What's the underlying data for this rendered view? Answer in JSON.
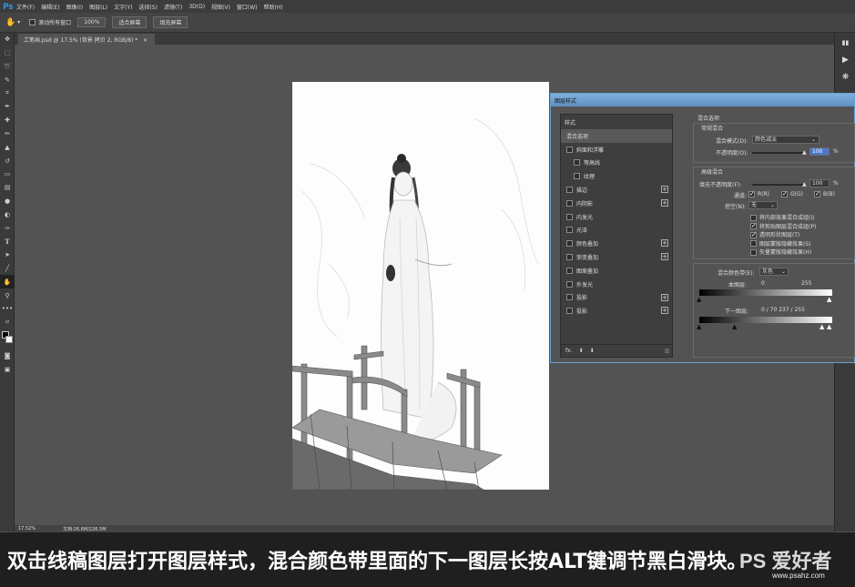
{
  "menubar": {
    "logo": "Ps",
    "items": [
      "文件(F)",
      "编辑(E)",
      "图像(I)",
      "图层(L)",
      "文字(Y)",
      "选择(S)",
      "滤镜(T)",
      "3D(D)",
      "视图(V)",
      "窗口(W)",
      "帮助(H)"
    ]
  },
  "options": {
    "scroll_all_label": "滚动所有窗口",
    "zoom_100": "100%",
    "fit_screen": "适合屏幕",
    "fill_screen": "填充屏幕"
  },
  "document": {
    "tab_title": "工笔画.psd @ 17.5% (背景 拷贝 2, RGB/8) *",
    "tab_close": "×"
  },
  "status": {
    "zoom": "17.52%",
    "doc_info": "文档:26.6M/226.5M"
  },
  "dialog": {
    "title": "图层样式",
    "styles_header": "样式",
    "styles": [
      {
        "label": "混合选项",
        "selected": true,
        "checkbox": false,
        "sub": false,
        "plus": false
      },
      {
        "label": "斜面和浮雕",
        "selected": false,
        "checkbox": true,
        "sub": false,
        "plus": false
      },
      {
        "label": "等高线",
        "selected": false,
        "checkbox": true,
        "sub": true,
        "plus": false
      },
      {
        "label": "纹理",
        "selected": false,
        "checkbox": true,
        "sub": true,
        "plus": false
      },
      {
        "label": "描边",
        "selected": false,
        "checkbox": true,
        "sub": false,
        "plus": true
      },
      {
        "label": "内阴影",
        "selected": false,
        "checkbox": true,
        "sub": false,
        "plus": true
      },
      {
        "label": "内发光",
        "selected": false,
        "checkbox": true,
        "sub": false,
        "plus": false
      },
      {
        "label": "光泽",
        "selected": false,
        "checkbox": true,
        "sub": false,
        "plus": false
      },
      {
        "label": "颜色叠加",
        "selected": false,
        "checkbox": true,
        "sub": false,
        "plus": true
      },
      {
        "label": "渐变叠加",
        "selected": false,
        "checkbox": true,
        "sub": false,
        "plus": true
      },
      {
        "label": "图案叠加",
        "selected": false,
        "checkbox": true,
        "sub": false,
        "plus": false
      },
      {
        "label": "外发光",
        "selected": false,
        "checkbox": true,
        "sub": false,
        "plus": false
      },
      {
        "label": "投影",
        "selected": false,
        "checkbox": true,
        "sub": false,
        "plus": true
      },
      {
        "label": "投影",
        "selected": false,
        "checkbox": true,
        "sub": false,
        "plus": true
      }
    ],
    "footer": {
      "fx": "fx.",
      "up": "⬆",
      "down": "⬇",
      "trash": "🗑"
    },
    "blend_options_title": "混合选项",
    "general_blend": "常规混合",
    "blend_mode_label": "混合模式(D):",
    "blend_mode_value": "颜色减淡",
    "opacity_label": "不透明度(O):",
    "opacity_value": "100",
    "percent": "%",
    "advanced_blend": "高级混合",
    "fill_opacity_label": "填充不透明度(F):",
    "fill_opacity_value": "100",
    "channels_label": "通道:",
    "channel_r": "R(R)",
    "channel_g": "G(G)",
    "channel_b": "B(B)",
    "knockout_label": "挖空(N):",
    "knockout_value": "无",
    "adv_options": [
      {
        "label": "将内部效果混合成组(I)",
        "checked": false
      },
      {
        "label": "将剪贴图层混合成组(P)",
        "checked": true
      },
      {
        "label": "透明形状图层(T)",
        "checked": true
      },
      {
        "label": "图层蒙版隐藏效果(S)",
        "checked": false
      },
      {
        "label": "矢量蒙版隐藏效果(H)",
        "checked": false
      }
    ],
    "blend_if_label": "混合颜色带(E):",
    "blend_if_value": "灰色",
    "this_layer_label": "本图层:",
    "this_layer_min": "0",
    "this_layer_max": "255",
    "underlying_label": "下一图层:",
    "underlying_values": "0 / 70   237 / 255"
  },
  "caption": {
    "text": "双击线稿图层打开图层样式，混合颜色带里面的下一图层长按ALT键调节黑白滑块。",
    "watermark": "PS 爱好者",
    "watermark_url": "www.psahz.com"
  }
}
